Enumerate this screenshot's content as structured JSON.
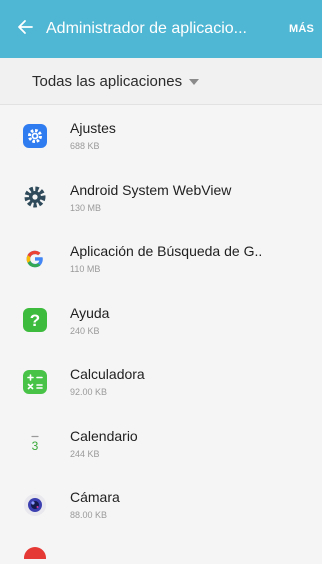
{
  "appbar": {
    "title": "Administrador de aplicacio...",
    "more_label": "MÁS",
    "background": "#4fb6d3"
  },
  "filter": {
    "label": "Todas las aplicaciones"
  },
  "apps": [
    {
      "name": "Ajustes",
      "size": "688 KB",
      "icon": "settings-icon"
    },
    {
      "name": "Android System WebView",
      "size": "130 MB",
      "icon": "gear-icon"
    },
    {
      "name": "Aplicación de Búsqueda de G..",
      "size": "110 MB",
      "icon": "google-icon"
    },
    {
      "name": "Ayuda",
      "size": "240 KB",
      "icon": "help-icon"
    },
    {
      "name": "Calculadora",
      "size": "92.00 KB",
      "icon": "calculator-icon"
    },
    {
      "name": "Calendario",
      "size": "244 KB",
      "icon": "calendar-icon"
    },
    {
      "name": "Cámara",
      "size": "88.00 KB",
      "icon": "camera-icon"
    }
  ]
}
